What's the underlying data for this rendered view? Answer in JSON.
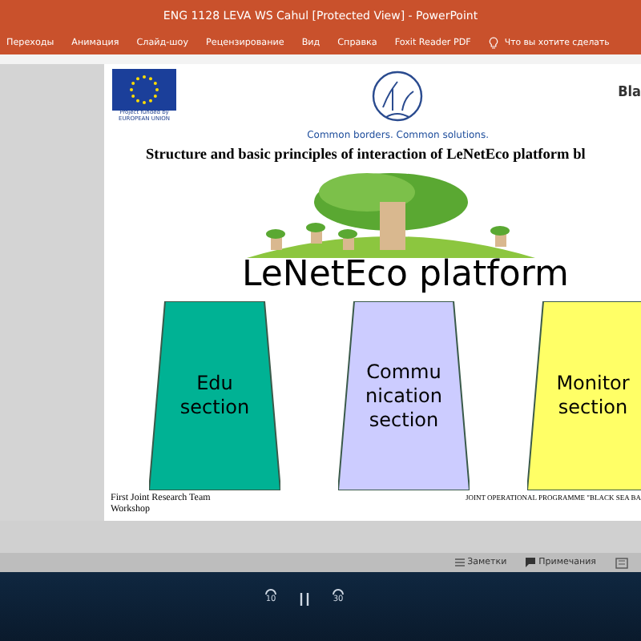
{
  "window": {
    "title": "ENG 1128 LEVA WS Cahul [Protected View]  -  PowerPoint"
  },
  "ribbon_tabs": [
    {
      "label": "Переходы"
    },
    {
      "label": "Анимация"
    },
    {
      "label": "Слайд-шоу"
    },
    {
      "label": "Рецензирование"
    },
    {
      "label": "Вид"
    },
    {
      "label": "Справка"
    },
    {
      "label": "Foxit Reader PDF"
    }
  ],
  "tell_me": {
    "placeholder": "Что вы хотите сделать"
  },
  "slide": {
    "eu_logo_caption": [
      "Project funded by",
      "EUROPEAN UNION"
    ],
    "motto": "Common borders. Common solutions.",
    "partner_logo_text": "Bla",
    "title": "Structure and basic principles of interaction of LeNetEco platform bl",
    "platform_label": "LeNetEco platform",
    "sections": [
      {
        "label": "Edu section",
        "color": "#00b294"
      },
      {
        "label": "Commu nication section",
        "color": "#ccccff"
      },
      {
        "label": "Monitor section",
        "color": "#ffff66"
      }
    ],
    "footer_left": "First Joint Research Team Workshop",
    "footer_right": "JOINT OPERATIONAL PROGRAMME \"BLACK SEA BA"
  },
  "status_bar": [
    {
      "kind": "notes",
      "label": "Заметки"
    },
    {
      "kind": "comments",
      "label": "Примечания"
    }
  ],
  "media_controls": {
    "back": "10",
    "forward": "30"
  }
}
